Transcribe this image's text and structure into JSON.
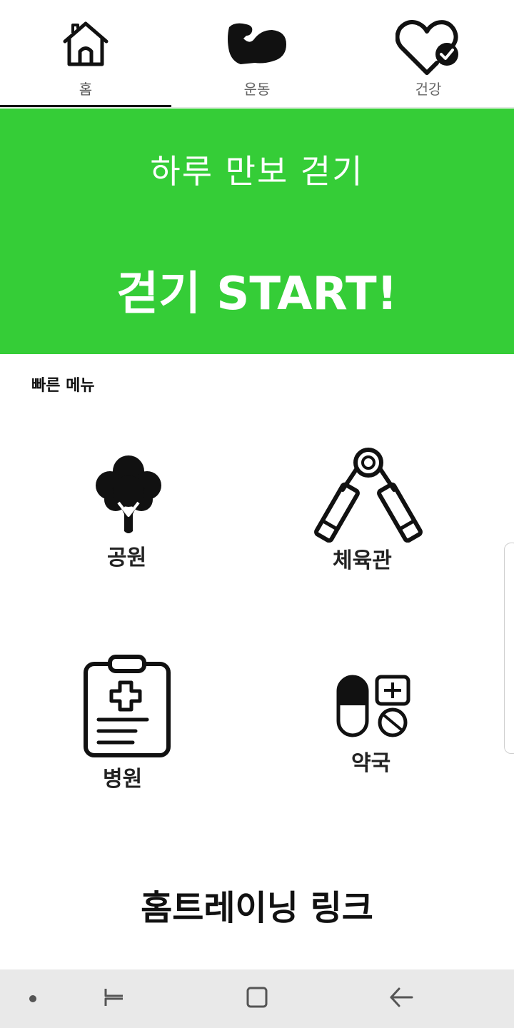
{
  "tabs": [
    {
      "label": "홈",
      "icon": "home-icon",
      "active": true
    },
    {
      "label": "운동",
      "icon": "muscle-arm-icon",
      "active": false
    },
    {
      "label": "건강",
      "icon": "heart-check-icon",
      "active": false
    }
  ],
  "banner": {
    "subtitle": "하루 만보 걷기",
    "cta": "걷기 START!",
    "background": "#35cd37"
  },
  "quick_menu": {
    "title": "빠른 메뉴",
    "items": [
      {
        "label": "공원",
        "icon": "tree-icon"
      },
      {
        "label": "체육관",
        "icon": "hand-grip-icon"
      },
      {
        "label": "병원",
        "icon": "medical-clipboard-icon"
      },
      {
        "label": "약국",
        "icon": "pills-icon"
      }
    ]
  },
  "home_training": {
    "label": "홈트레이닝 링크"
  },
  "system_nav": {
    "buttons": [
      "dot-icon",
      "recent-apps-icon",
      "home-square-icon",
      "back-arrow-icon"
    ],
    "background": "#e9e9e9"
  }
}
